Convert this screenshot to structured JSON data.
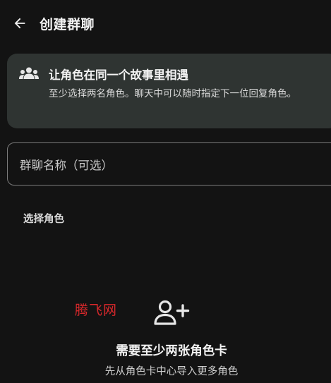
{
  "header": {
    "title": "创建群聊",
    "back_icon": "arrow-left-icon"
  },
  "info_card": {
    "icon": "group-icon",
    "title": "让角色在同一个故事里相遇",
    "description": "至少选择两名角色。聊天中可以随时指定下一位回复角色。"
  },
  "name_field": {
    "placeholder": "群聊名称（可选）",
    "value": ""
  },
  "section": {
    "label": "选择角色"
  },
  "watermark": {
    "text": "腾飞网"
  },
  "empty_state": {
    "icon": "add-person-icon",
    "title": "需要至少两张角色卡",
    "subtitle": "先从角色卡中心导入更多角色"
  },
  "colors": {
    "background": "#131313",
    "card": "#2f3432",
    "outline": "#7b7b7b",
    "watermark": "#d8282b"
  }
}
